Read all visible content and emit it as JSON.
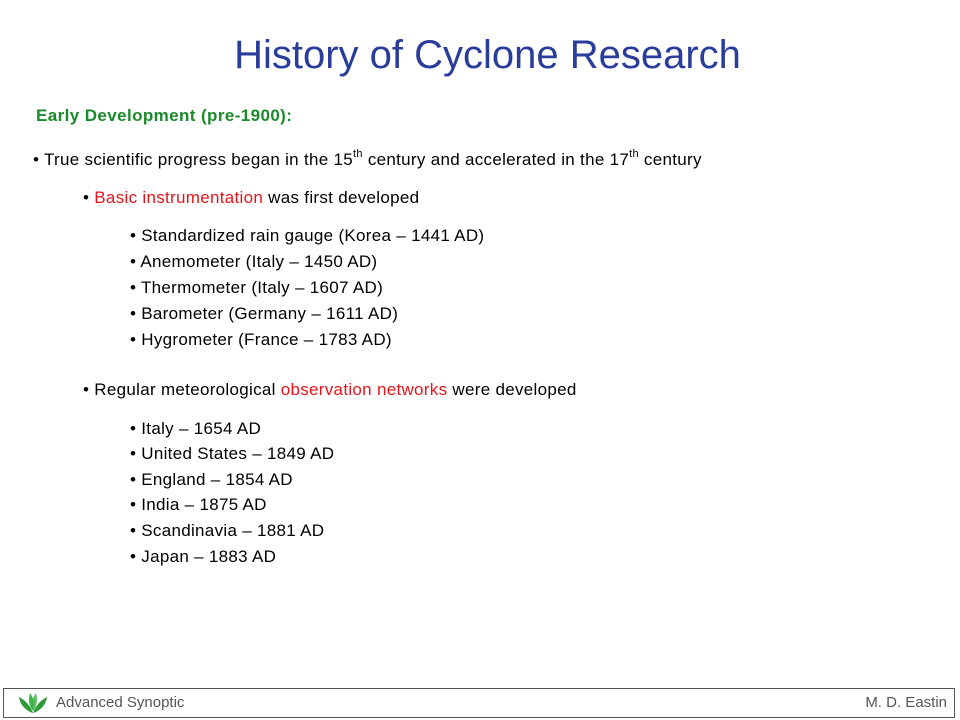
{
  "title": "History of Cyclone Research",
  "section_heading": "Early Development (pre-1900):",
  "intro": {
    "bullet": "•",
    "part1": "True scientific progress began in the 15",
    "sup1": "th",
    "part2": " century and accelerated in the 17",
    "sup2": "th",
    "part3": " century"
  },
  "instrumentation": {
    "bullet": "•",
    "highlight": "Basic instrumentation",
    "rest": " was first developed",
    "highlight_color": "#e8141b",
    "items": [
      "• Standardized rain gauge (Korea – 1441 AD)",
      "• Anemometer (Italy – 1450 AD)",
      "• Thermometer (Italy – 1607 AD)",
      "• Barometer (Germany – 1611 AD)",
      "• Hygrometer (France – 1783 AD)"
    ]
  },
  "networks": {
    "bullet": "•",
    "before": "Regular meteorological ",
    "highlight": "observation networks",
    "after": " were developed",
    "items": [
      "• Italy – 1654 AD",
      "• United States – 1849 AD",
      "• England – 1854 AD",
      "• India – 1875 AD",
      "• Scandinavia – 1881 AD",
      "• Japan – 1883 AD"
    ]
  },
  "footer": {
    "left": "Advanced Synoptic",
    "right": "M. D. Eastin",
    "logo_icon": "leaf-logo-icon"
  },
  "colors": {
    "title": "#2b3d9a",
    "heading": "#1a8a2a",
    "highlight": "#e8141b",
    "footer_text": "#555555"
  }
}
